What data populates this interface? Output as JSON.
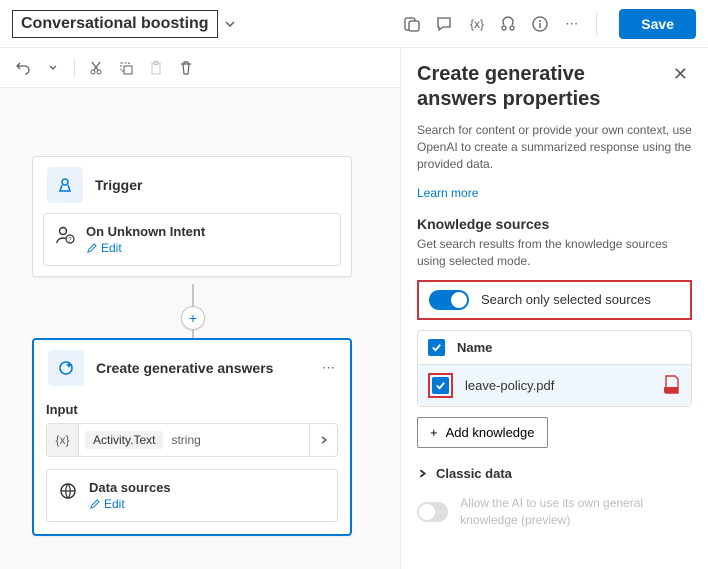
{
  "header": {
    "title": "Conversational boosting",
    "save": "Save"
  },
  "canvas": {
    "trigger": {
      "title": "Trigger",
      "inner_label": "On Unknown Intent",
      "edit": "Edit"
    },
    "gen": {
      "title": "Create generative answers",
      "input_label": "Input",
      "input_value": "Activity.Text",
      "input_type": "string",
      "data_sources_label": "Data sources",
      "edit": "Edit"
    }
  },
  "panel": {
    "title": "Create generative answers properties",
    "desc": "Search for content or provide your own context, use OpenAI to create a summarized response using the provided data.",
    "learn_more": "Learn more",
    "ks_heading": "Knowledge sources",
    "ks_desc": "Get search results from the knowledge sources using selected mode.",
    "toggle_label": "Search only selected sources",
    "col_name": "Name",
    "file_name": "leave-policy.pdf",
    "add_knowledge": "Add knowledge",
    "classic_data": "Classic data",
    "allow_label": "Allow the AI to use its own general knowledge (preview)"
  }
}
